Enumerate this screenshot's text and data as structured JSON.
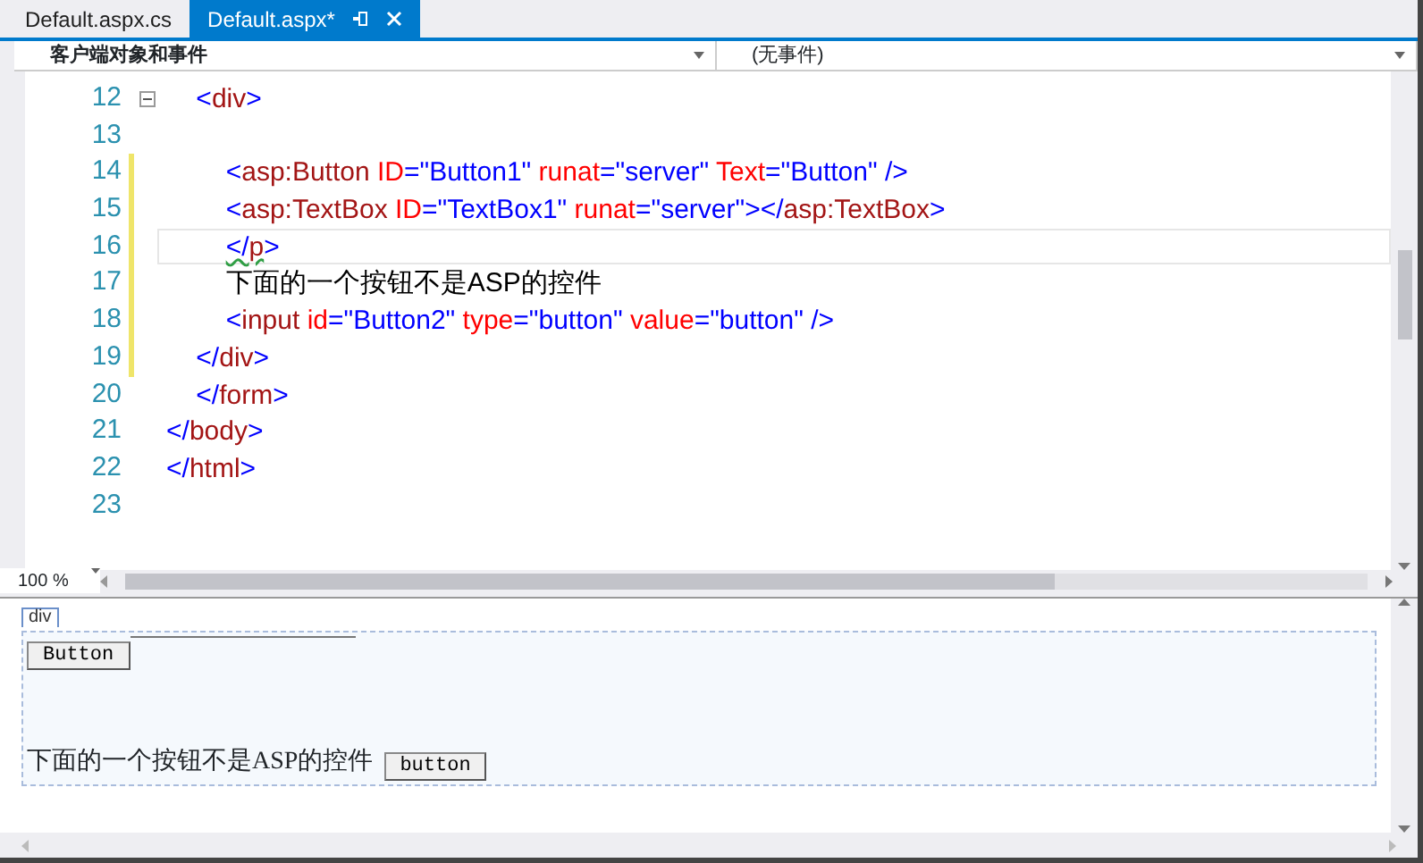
{
  "tabs": [
    {
      "label": "Default.aspx.cs",
      "selected": false
    },
    {
      "label": "Default.aspx*",
      "selected": true
    }
  ],
  "navigation_bar": {
    "object_dropdown": "客户端对象和事件",
    "event_dropdown": "(无事件)"
  },
  "editor": {
    "lines": [
      {
        "number": "12",
        "changed": false,
        "fold": true,
        "current": false,
        "segments": [
          {
            "t": "    <",
            "kind": "punct"
          },
          {
            "t": "div",
            "kind": "tag"
          },
          {
            "t": ">",
            "kind": "punct"
          }
        ]
      },
      {
        "number": "13",
        "changed": false,
        "fold": false,
        "current": false
      },
      {
        "number": "14",
        "changed": true,
        "fold": false,
        "current": false,
        "segments": [
          {
            "t": "        <",
            "kind": "punct"
          },
          {
            "t": "asp:Button",
            "kind": "tag"
          },
          {
            "t": " ID",
            "kind": "attr"
          },
          {
            "t": "=\"Button1\"",
            "kind": "punct"
          },
          {
            "t": " runat",
            "kind": "attr"
          },
          {
            "t": "=\"server\"",
            "kind": "punct"
          },
          {
            "t": " Text",
            "kind": "attr"
          },
          {
            "t": "=\"Button\" />",
            "kind": "punct"
          }
        ]
      },
      {
        "number": "15",
        "changed": true,
        "fold": false,
        "current": false,
        "segments": [
          {
            "t": "        <",
            "kind": "punct"
          },
          {
            "t": "asp:TextBox",
            "kind": "tag"
          },
          {
            "t": " ID",
            "kind": "attr"
          },
          {
            "t": "=\"TextBox1\"",
            "kind": "punct"
          },
          {
            "t": " runat",
            "kind": "attr"
          },
          {
            "t": "=\"server\"></",
            "kind": "punct"
          },
          {
            "t": "asp:TextBox",
            "kind": "tag"
          },
          {
            "t": ">",
            "kind": "punct"
          }
        ]
      },
      {
        "number": "16",
        "changed": true,
        "fold": false,
        "current": true,
        "segments": [
          {
            "t": "        </",
            "kind": "punct",
            "error": true
          },
          {
            "t": "p",
            "kind": "tag",
            "error": true
          },
          {
            "t": ">",
            "kind": "punct"
          }
        ]
      },
      {
        "number": "17",
        "changed": true,
        "fold": false,
        "current": false,
        "segments": [
          {
            "t": "        下面的一个按钮不是ASP的控件",
            "kind": "text"
          }
        ]
      },
      {
        "number": "18",
        "changed": true,
        "fold": false,
        "current": false,
        "segments": [
          {
            "t": "        <",
            "kind": "punct"
          },
          {
            "t": "input",
            "kind": "tag"
          },
          {
            "t": " id",
            "kind": "attr"
          },
          {
            "t": "=\"Button2\"",
            "kind": "punct"
          },
          {
            "t": " type",
            "kind": "attr"
          },
          {
            "t": "=\"button\"",
            "kind": "punct"
          },
          {
            "t": " value",
            "kind": "attr"
          },
          {
            "t": "=\"button\" />",
            "kind": "punct"
          }
        ]
      },
      {
        "number": "19",
        "changed": true,
        "fold": false,
        "current": false,
        "segments": [
          {
            "t": "    </",
            "kind": "punct"
          },
          {
            "t": "div",
            "kind": "tag"
          },
          {
            "t": ">",
            "kind": "punct"
          }
        ]
      },
      {
        "number": "20",
        "changed": false,
        "fold": false,
        "current": false,
        "segments": [
          {
            "t": "    </",
            "kind": "punct"
          },
          {
            "t": "form",
            "kind": "tag"
          },
          {
            "t": ">",
            "kind": "punct"
          }
        ]
      },
      {
        "number": "21",
        "changed": false,
        "fold": false,
        "current": false,
        "segments": [
          {
            "t": "</",
            "kind": "punct"
          },
          {
            "t": "body",
            "kind": "tag"
          },
          {
            "t": ">",
            "kind": "punct"
          }
        ]
      },
      {
        "number": "22",
        "changed": false,
        "fold": false,
        "current": false,
        "segments": [
          {
            "t": "</",
            "kind": "punct"
          },
          {
            "t": "html",
            "kind": "tag"
          },
          {
            "t": ">",
            "kind": "punct"
          }
        ]
      },
      {
        "number": "23",
        "changed": false,
        "fold": false,
        "current": false
      }
    ]
  },
  "zoom": "100 %",
  "design_view": {
    "tag_label": "div",
    "server_button": "Button",
    "text": "下面的一个按钮不是ASP的控件",
    "html_button": "button"
  }
}
